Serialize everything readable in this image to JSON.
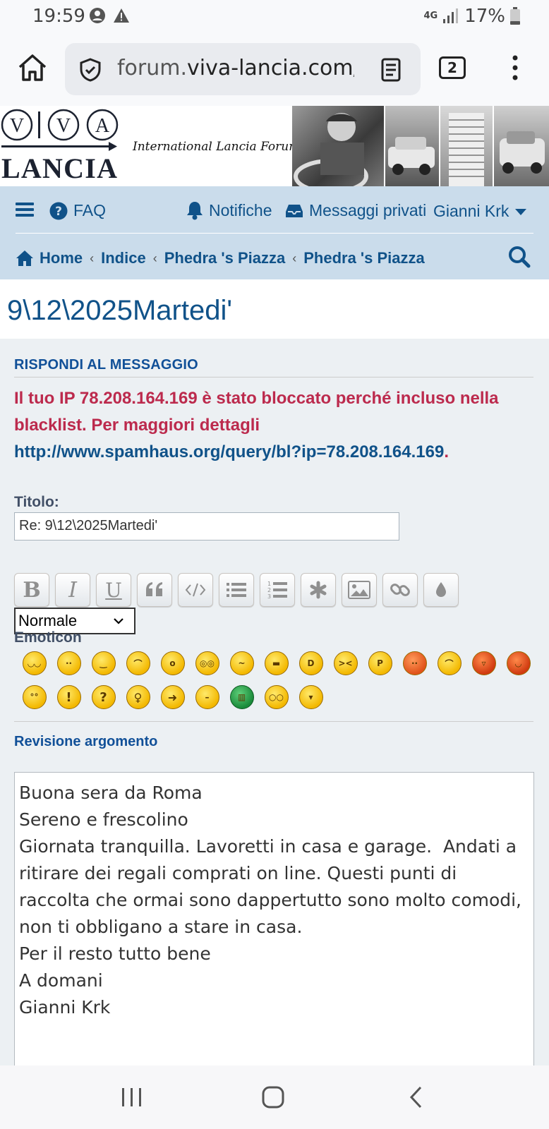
{
  "status": {
    "time": "19:59",
    "network": "4G",
    "battery": "17%"
  },
  "browser": {
    "url_pre": "forum.",
    "url_domain": "viva-lancia.com",
    "url_post": "/p",
    "tab_count": "2"
  },
  "header": {
    "tagline": "International Lancia Forums",
    "logo_letters": [
      "V",
      "V",
      "A"
    ],
    "logo_text": "LANCIA"
  },
  "nav": {
    "faq": "FAQ",
    "notifications": "Notifiche",
    "messages": "Messaggi privati",
    "user": "Gianni Krk",
    "breadcrumbs": [
      "Home",
      "Indice",
      "Phedra 's Piazza",
      "Phedra 's Piazza"
    ]
  },
  "topic": {
    "title": "9\\12\\2025Martedi'"
  },
  "reply": {
    "heading": "RISPONDI AL MESSAGGIO",
    "error_text": "Il tuo IP 78.208.164.169 è stato bloccato perché incluso nella blacklist. Per maggiori dettagli ",
    "error_link": "http://www.spamhaus.org/query/bl?ip=78.208.164.169",
    "error_end": ".",
    "title_label": "Titolo:",
    "title_value": "Re: 9\\12\\2025Martedi'",
    "size_select": "Normale",
    "emoticon_label": "Emoticon",
    "revision_label": "Revisione argomento",
    "message": "Buona sera da Roma\nSereno e frescolino\nGiornata tranquilla. Lavoretti in casa e garage.  Andati a ritirare dei regali comprati on line. Questi punti di raccolta che ormai sono dappertutto sono molto comodi, non ti obbligano a stare in casa.\nPer il resto tutto bene\nA domani\nGianni Krk"
  },
  "toolbar_buttons": [
    "bold",
    "italic",
    "underline",
    "quote",
    "code",
    "list",
    "list-numbered",
    "asterisk",
    "image",
    "link",
    "color"
  ],
  "emoticons_row1": [
    "biggrin",
    "smile",
    "wink",
    "sad",
    "surprised",
    "eek",
    "confused",
    "cool",
    "lol",
    "mad",
    "razz",
    "redface",
    "cry",
    "evil",
    "twisted"
  ],
  "emoticons_row2": [
    "rolleyes",
    "exclaim",
    "question",
    "idea",
    "arrow",
    "neutral",
    "mrgreen",
    "geek",
    "ugeek"
  ],
  "colors": {
    "link": "#105289",
    "error": "#bc2a4d",
    "navbar": "#cadceb",
    "panel": "#ecf0f3"
  }
}
